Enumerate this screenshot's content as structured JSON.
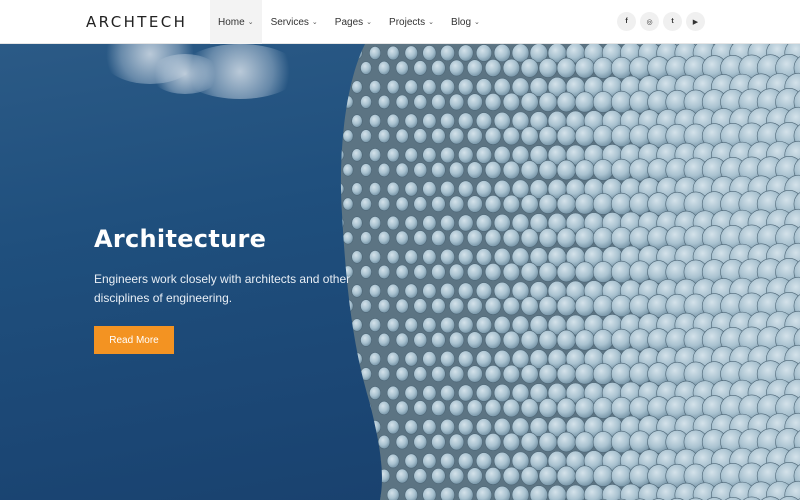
{
  "header": {
    "logo": "ARCHTECH",
    "nav": [
      {
        "label": "Home",
        "active": true
      },
      {
        "label": "Services",
        "active": false
      },
      {
        "label": "Pages",
        "active": false
      },
      {
        "label": "Projects",
        "active": false
      },
      {
        "label": "Blog",
        "active": false
      }
    ],
    "social": [
      {
        "icon": "facebook-icon",
        "glyph": "f"
      },
      {
        "icon": "instagram-icon",
        "glyph": "◎"
      },
      {
        "icon": "twitter-icon",
        "glyph": "t"
      },
      {
        "icon": "youtube-icon",
        "glyph": "▶"
      }
    ]
  },
  "hero": {
    "title": "Architecture",
    "text": "Engineers work closely with architects and other disciplines of engineering.",
    "button_label": "Read More",
    "accent_color": "#f39322",
    "background_color": "#1f4f7d"
  }
}
